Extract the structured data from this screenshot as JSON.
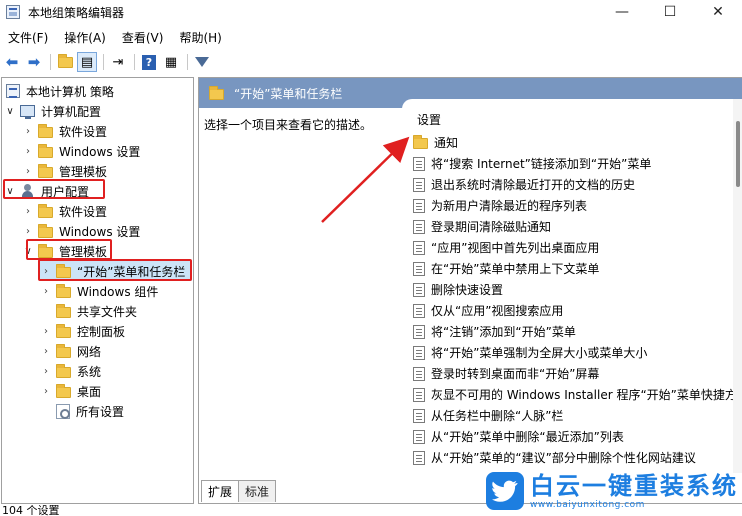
{
  "window": {
    "title": "本地组策略编辑器",
    "controls": {
      "minimize": "—",
      "maximize": "☐",
      "close": "✕"
    }
  },
  "menubar": {
    "items": [
      "文件(F)",
      "操作(A)",
      "查看(V)",
      "帮助(H)"
    ]
  },
  "toolbar": {
    "icons": [
      "back-arrow-icon",
      "forward-arrow-icon",
      "up-folder-icon",
      "show-hide-tree-icon",
      "export-list-icon",
      "help-icon",
      "properties-icon",
      "filter-icon"
    ]
  },
  "tree": {
    "root": "本地计算机 策略",
    "computer_config": "计算机配置",
    "cc_software": "软件设置",
    "cc_windows": "Windows 设置",
    "cc_admin": "管理模板",
    "user_config": "用户配置",
    "uc_software": "软件设置",
    "uc_windows": "Windows 设置",
    "uc_admin": "管理模板",
    "start_taskbar": "“开始”菜单和任务栏",
    "windows_components": "Windows 组件",
    "shared_folders": "共享文件夹",
    "control_panel": "控制面板",
    "network": "网络",
    "system": "系统",
    "desktop": "桌面",
    "all_settings": "所有设置"
  },
  "right": {
    "header": "“开始”菜单和任务栏",
    "description": "选择一个项目来查看它的描述。",
    "column_header": "设置",
    "folder_item": "通知",
    "settings": [
      "将“搜索 Internet”链接添加到“开始”菜单",
      "退出系统时清除最近打开的文档的历史",
      "为新用户清除最近的程序列表",
      "登录期间清除磁贴通知",
      "“应用”视图中首先列出桌面应用",
      "在“开始”菜单中禁用上下文菜单",
      "删除快速设置",
      "仅从“应用”视图搜索应用",
      "将“注销”添加到“开始”菜单",
      "将“开始”菜单强制为全屏大小或菜单大小",
      "登录时转到桌面而非“开始”屏幕",
      "灰显不可用的 Windows Installer 程序“开始”菜单快捷方",
      "从任务栏中删除“人脉”栏",
      "从“开始”菜单中删除“最近添加”列表",
      "从“开始”菜单的“建议”部分中删除个性化网站建议"
    ],
    "tabs": [
      "扩展",
      "标准"
    ]
  },
  "status": {
    "text": "104 个设置"
  },
  "watermark": {
    "name": "白云一键重装系统",
    "url": "www.baiyunxitong.com"
  }
}
